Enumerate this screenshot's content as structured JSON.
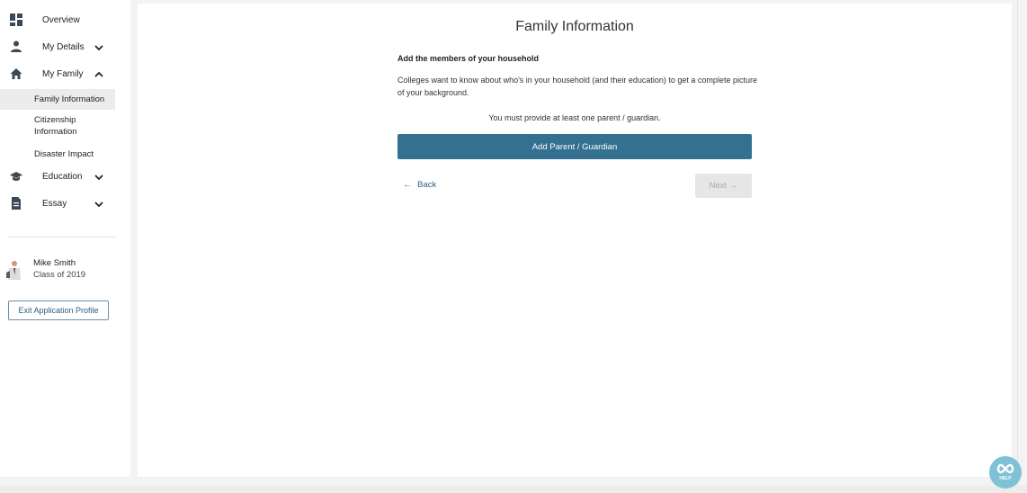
{
  "sidebar": {
    "items": [
      {
        "label": "Overview",
        "icon": "dashboard-icon"
      },
      {
        "label": "My Details",
        "icon": "person-icon"
      },
      {
        "label": "My Family",
        "icon": "home-icon"
      },
      {
        "label": "Education",
        "icon": "graduation-cap-icon"
      },
      {
        "label": "Essay",
        "icon": "document-icon"
      }
    ],
    "subitems": [
      {
        "label": "Family Information"
      },
      {
        "label": "Citizenship Information"
      },
      {
        "label": "Disaster Impact"
      }
    ],
    "user": {
      "name": "Mike Smith",
      "class": "Class of 2019"
    },
    "exit_label": "Exit Application Profile"
  },
  "main": {
    "title": "Family Information",
    "heading": "Add the members of your household",
    "description": "Colleges want to know about who's in your household (and their education) to get a complete picture of your background.",
    "notice": "You must provide at least one parent / guardian.",
    "add_label": "Add Parent / Guardian",
    "back_label": "Back",
    "next_label": "Next"
  },
  "help_label": "HELP",
  "colors": {
    "accent": "#34708f",
    "link": "#2d5f80",
    "help_bubble": "#7fc2d6"
  }
}
